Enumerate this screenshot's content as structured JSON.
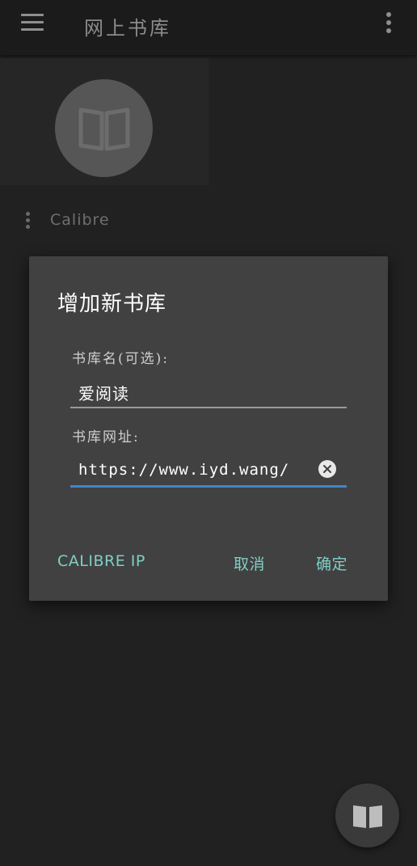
{
  "appbar": {
    "title": "网上书库",
    "menu_icon": "hamburger-menu-icon",
    "overflow_icon": "more-vertical-icon"
  },
  "library": {
    "name": "Calibre",
    "icon": "book-open-icon"
  },
  "dialog": {
    "title": "增加新书库",
    "name_field": {
      "label": "书库名(可选):",
      "value": "爱阅读"
    },
    "url_field": {
      "label": "书库网址:",
      "value": "https://www.iyd.wang/"
    },
    "buttons": {
      "calibre_ip": "CALIBRE IP",
      "cancel": "取消",
      "confirm": "确定"
    }
  },
  "fab": {
    "icon": "book-open-icon"
  },
  "colors": {
    "background": "#212121",
    "dialog": "#414141",
    "accent_text": "#7fcfc4",
    "focus_underline": "#3f86c9"
  }
}
